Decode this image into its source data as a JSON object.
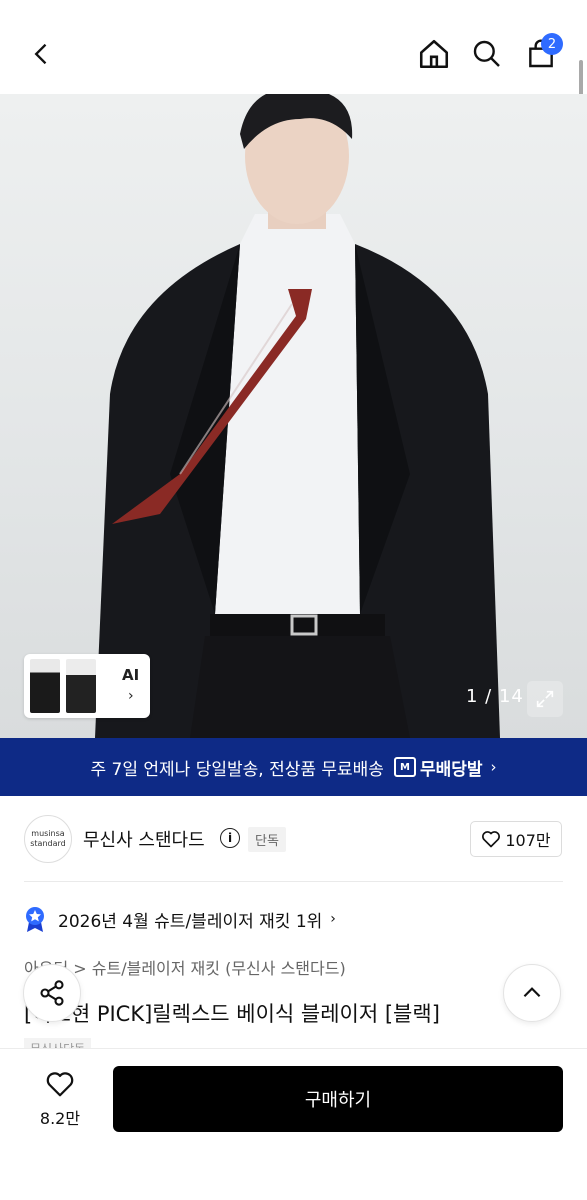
{
  "header": {
    "back_icon": "chevron-left-icon",
    "home_icon": "home-icon",
    "search_icon": "search-icon",
    "cart_icon": "shopping-bag-icon",
    "cart_count": "2"
  },
  "gallery": {
    "thumb_label": "AI",
    "counter": "1 / 14"
  },
  "banner": {
    "text": "주 7일 언제나 당일발송, 전상품 무료배송",
    "badge": "무배당발",
    "badge_icon_text": "M"
  },
  "brand": {
    "logo_line1": "musinsa",
    "logo_line2": "standard",
    "name": "무신사 스탠다드",
    "exclusive": "단독",
    "likes": "107만"
  },
  "ranking": {
    "text": "2026년 4월 슈트/블레이저 재킷 1위"
  },
  "breadcrumb": {
    "cat1": "아우터",
    "sep": ">",
    "cat2": "슈트/블레이저 재킷 (무신사 스탠다드)"
  },
  "product": {
    "title": "[이도현 PICK]릴렉스드 베이식 블레이저 [블랙]",
    "tag": "무신사단독"
  },
  "bottom_bar": {
    "wish_count": "8.2만",
    "buy_label": "구매하기"
  },
  "colors": {
    "banner_bg": "#0e2a86",
    "badge_blue": "#2f6bff",
    "buy_bg": "#000000"
  }
}
